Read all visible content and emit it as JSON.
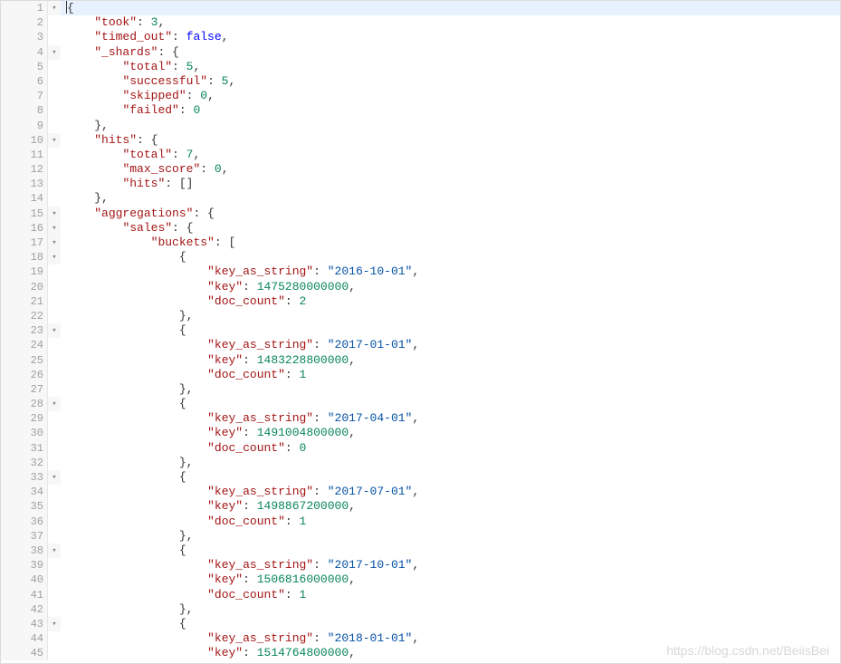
{
  "watermark": "https://blog.csdn.net/BeiisBei",
  "lines": [
    {
      "n": 1,
      "fold": "▾",
      "active": true,
      "tokens": [
        {
          "t": "cursor"
        },
        {
          "t": "punct",
          "v": "{"
        }
      ]
    },
    {
      "n": 2,
      "indent": 1,
      "tokens": [
        {
          "t": "key",
          "v": "\"took\""
        },
        {
          "t": "punct",
          "v": ": "
        },
        {
          "t": "number",
          "v": "3"
        },
        {
          "t": "punct",
          "v": ","
        }
      ]
    },
    {
      "n": 3,
      "indent": 1,
      "tokens": [
        {
          "t": "key",
          "v": "\"timed_out\""
        },
        {
          "t": "punct",
          "v": ": "
        },
        {
          "t": "boolean",
          "v": "false"
        },
        {
          "t": "punct",
          "v": ","
        }
      ]
    },
    {
      "n": 4,
      "fold": "▾",
      "indent": 1,
      "tokens": [
        {
          "t": "key",
          "v": "\"_shards\""
        },
        {
          "t": "punct",
          "v": ": {"
        }
      ]
    },
    {
      "n": 5,
      "indent": 2,
      "tokens": [
        {
          "t": "key",
          "v": "\"total\""
        },
        {
          "t": "punct",
          "v": ": "
        },
        {
          "t": "number",
          "v": "5"
        },
        {
          "t": "punct",
          "v": ","
        }
      ]
    },
    {
      "n": 6,
      "indent": 2,
      "tokens": [
        {
          "t": "key",
          "v": "\"successful\""
        },
        {
          "t": "punct",
          "v": ": "
        },
        {
          "t": "number",
          "v": "5"
        },
        {
          "t": "punct",
          "v": ","
        }
      ]
    },
    {
      "n": 7,
      "indent": 2,
      "tokens": [
        {
          "t": "key",
          "v": "\"skipped\""
        },
        {
          "t": "punct",
          "v": ": "
        },
        {
          "t": "number",
          "v": "0"
        },
        {
          "t": "punct",
          "v": ","
        }
      ]
    },
    {
      "n": 8,
      "indent": 2,
      "tokens": [
        {
          "t": "key",
          "v": "\"failed\""
        },
        {
          "t": "punct",
          "v": ": "
        },
        {
          "t": "number",
          "v": "0"
        }
      ]
    },
    {
      "n": 9,
      "indent": 1,
      "tokens": [
        {
          "t": "punct",
          "v": "},"
        }
      ]
    },
    {
      "n": 10,
      "fold": "▾",
      "indent": 1,
      "tokens": [
        {
          "t": "key",
          "v": "\"hits\""
        },
        {
          "t": "punct",
          "v": ": {"
        }
      ]
    },
    {
      "n": 11,
      "indent": 2,
      "tokens": [
        {
          "t": "key",
          "v": "\"total\""
        },
        {
          "t": "punct",
          "v": ": "
        },
        {
          "t": "number",
          "v": "7"
        },
        {
          "t": "punct",
          "v": ","
        }
      ]
    },
    {
      "n": 12,
      "indent": 2,
      "tokens": [
        {
          "t": "key",
          "v": "\"max_score\""
        },
        {
          "t": "punct",
          "v": ": "
        },
        {
          "t": "number",
          "v": "0"
        },
        {
          "t": "punct",
          "v": ","
        }
      ]
    },
    {
      "n": 13,
      "indent": 2,
      "tokens": [
        {
          "t": "key",
          "v": "\"hits\""
        },
        {
          "t": "punct",
          "v": ": []"
        }
      ]
    },
    {
      "n": 14,
      "indent": 1,
      "tokens": [
        {
          "t": "punct",
          "v": "},"
        }
      ]
    },
    {
      "n": 15,
      "fold": "▾",
      "indent": 1,
      "tokens": [
        {
          "t": "key",
          "v": "\"aggregations\""
        },
        {
          "t": "punct",
          "v": ": {"
        }
      ]
    },
    {
      "n": 16,
      "fold": "▾",
      "indent": 2,
      "tokens": [
        {
          "t": "key",
          "v": "\"sales\""
        },
        {
          "t": "punct",
          "v": ": {"
        }
      ]
    },
    {
      "n": 17,
      "fold": "▾",
      "indent": 3,
      "tokens": [
        {
          "t": "key",
          "v": "\"buckets\""
        },
        {
          "t": "punct",
          "v": ": ["
        }
      ]
    },
    {
      "n": 18,
      "fold": "▾",
      "indent": 4,
      "tokens": [
        {
          "t": "punct",
          "v": "{"
        }
      ]
    },
    {
      "n": 19,
      "indent": 5,
      "tokens": [
        {
          "t": "key",
          "v": "\"key_as_string\""
        },
        {
          "t": "punct",
          "v": ": "
        },
        {
          "t": "string",
          "v": "\"2016-10-01\""
        },
        {
          "t": "punct",
          "v": ","
        }
      ]
    },
    {
      "n": 20,
      "indent": 5,
      "tokens": [
        {
          "t": "key",
          "v": "\"key\""
        },
        {
          "t": "punct",
          "v": ": "
        },
        {
          "t": "number",
          "v": "1475280000000"
        },
        {
          "t": "punct",
          "v": ","
        }
      ]
    },
    {
      "n": 21,
      "indent": 5,
      "tokens": [
        {
          "t": "key",
          "v": "\"doc_count\""
        },
        {
          "t": "punct",
          "v": ": "
        },
        {
          "t": "number",
          "v": "2"
        }
      ]
    },
    {
      "n": 22,
      "indent": 4,
      "tokens": [
        {
          "t": "punct",
          "v": "},"
        }
      ]
    },
    {
      "n": 23,
      "fold": "▾",
      "indent": 4,
      "tokens": [
        {
          "t": "punct",
          "v": "{"
        }
      ]
    },
    {
      "n": 24,
      "indent": 5,
      "tokens": [
        {
          "t": "key",
          "v": "\"key_as_string\""
        },
        {
          "t": "punct",
          "v": ": "
        },
        {
          "t": "string",
          "v": "\"2017-01-01\""
        },
        {
          "t": "punct",
          "v": ","
        }
      ]
    },
    {
      "n": 25,
      "indent": 5,
      "tokens": [
        {
          "t": "key",
          "v": "\"key\""
        },
        {
          "t": "punct",
          "v": ": "
        },
        {
          "t": "number",
          "v": "1483228800000"
        },
        {
          "t": "punct",
          "v": ","
        }
      ]
    },
    {
      "n": 26,
      "indent": 5,
      "tokens": [
        {
          "t": "key",
          "v": "\"doc_count\""
        },
        {
          "t": "punct",
          "v": ": "
        },
        {
          "t": "number",
          "v": "1"
        }
      ]
    },
    {
      "n": 27,
      "indent": 4,
      "tokens": [
        {
          "t": "punct",
          "v": "},"
        }
      ]
    },
    {
      "n": 28,
      "fold": "▾",
      "indent": 4,
      "tokens": [
        {
          "t": "punct",
          "v": "{"
        }
      ]
    },
    {
      "n": 29,
      "indent": 5,
      "tokens": [
        {
          "t": "key",
          "v": "\"key_as_string\""
        },
        {
          "t": "punct",
          "v": ": "
        },
        {
          "t": "string",
          "v": "\"2017-04-01\""
        },
        {
          "t": "punct",
          "v": ","
        }
      ]
    },
    {
      "n": 30,
      "indent": 5,
      "tokens": [
        {
          "t": "key",
          "v": "\"key\""
        },
        {
          "t": "punct",
          "v": ": "
        },
        {
          "t": "number",
          "v": "1491004800000"
        },
        {
          "t": "punct",
          "v": ","
        }
      ]
    },
    {
      "n": 31,
      "indent": 5,
      "tokens": [
        {
          "t": "key",
          "v": "\"doc_count\""
        },
        {
          "t": "punct",
          "v": ": "
        },
        {
          "t": "number",
          "v": "0"
        }
      ]
    },
    {
      "n": 32,
      "indent": 4,
      "tokens": [
        {
          "t": "punct",
          "v": "},"
        }
      ]
    },
    {
      "n": 33,
      "fold": "▾",
      "indent": 4,
      "tokens": [
        {
          "t": "punct",
          "v": "{"
        }
      ]
    },
    {
      "n": 34,
      "indent": 5,
      "tokens": [
        {
          "t": "key",
          "v": "\"key_as_string\""
        },
        {
          "t": "punct",
          "v": ": "
        },
        {
          "t": "string",
          "v": "\"2017-07-01\""
        },
        {
          "t": "punct",
          "v": ","
        }
      ]
    },
    {
      "n": 35,
      "indent": 5,
      "tokens": [
        {
          "t": "key",
          "v": "\"key\""
        },
        {
          "t": "punct",
          "v": ": "
        },
        {
          "t": "number",
          "v": "1498867200000"
        },
        {
          "t": "punct",
          "v": ","
        }
      ]
    },
    {
      "n": 36,
      "indent": 5,
      "tokens": [
        {
          "t": "key",
          "v": "\"doc_count\""
        },
        {
          "t": "punct",
          "v": ": "
        },
        {
          "t": "number",
          "v": "1"
        }
      ]
    },
    {
      "n": 37,
      "indent": 4,
      "tokens": [
        {
          "t": "punct",
          "v": "},"
        }
      ]
    },
    {
      "n": 38,
      "fold": "▾",
      "indent": 4,
      "tokens": [
        {
          "t": "punct",
          "v": "{"
        }
      ]
    },
    {
      "n": 39,
      "indent": 5,
      "tokens": [
        {
          "t": "key",
          "v": "\"key_as_string\""
        },
        {
          "t": "punct",
          "v": ": "
        },
        {
          "t": "string",
          "v": "\"2017-10-01\""
        },
        {
          "t": "punct",
          "v": ","
        }
      ]
    },
    {
      "n": 40,
      "indent": 5,
      "tokens": [
        {
          "t": "key",
          "v": "\"key\""
        },
        {
          "t": "punct",
          "v": ": "
        },
        {
          "t": "number",
          "v": "1506816000000"
        },
        {
          "t": "punct",
          "v": ","
        }
      ]
    },
    {
      "n": 41,
      "indent": 5,
      "tokens": [
        {
          "t": "key",
          "v": "\"doc_count\""
        },
        {
          "t": "punct",
          "v": ": "
        },
        {
          "t": "number",
          "v": "1"
        }
      ]
    },
    {
      "n": 42,
      "indent": 4,
      "tokens": [
        {
          "t": "punct",
          "v": "},"
        }
      ]
    },
    {
      "n": 43,
      "fold": "▾",
      "indent": 4,
      "tokens": [
        {
          "t": "punct",
          "v": "{"
        }
      ]
    },
    {
      "n": 44,
      "indent": 5,
      "tokens": [
        {
          "t": "key",
          "v": "\"key_as_string\""
        },
        {
          "t": "punct",
          "v": ": "
        },
        {
          "t": "string",
          "v": "\"2018-01-01\""
        },
        {
          "t": "punct",
          "v": ","
        }
      ]
    },
    {
      "n": 45,
      "indent": 5,
      "tokens": [
        {
          "t": "key",
          "v": "\"key\""
        },
        {
          "t": "punct",
          "v": ": "
        },
        {
          "t": "number",
          "v": "1514764800000"
        },
        {
          "t": "punct",
          "v": ","
        }
      ]
    }
  ]
}
